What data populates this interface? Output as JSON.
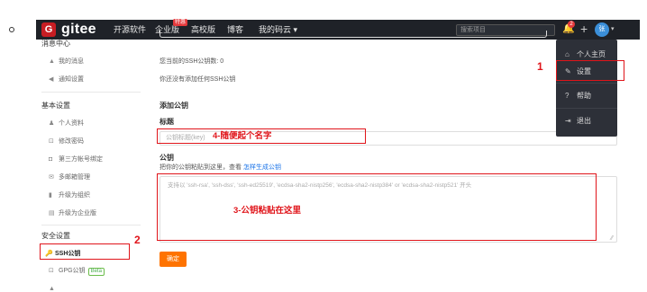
{
  "topnav": {
    "logo_text": "gitee",
    "items": [
      "开源软件",
      "企业版",
      "高校版",
      "博客",
      "我的码云 ▾"
    ],
    "enterprise_badge": "特惠",
    "search_placeholder": "搜索项目",
    "notification_count": "2",
    "avatar_text": "张"
  },
  "sidebar": {
    "message_center": "消息中心",
    "my_messages": "我的消息",
    "notification_settings": "通知设置",
    "basic_settings": "基本设置",
    "profile": "个人资料",
    "change_password": "修改密码",
    "third_party": "第三方帐号绑定",
    "multi_email": "多邮箱管理",
    "upgrade_org": "升级为组织",
    "upgrade_enterprise": "升级为企业版",
    "security_settings": "安全设置",
    "ssh_keys": "SSH公钥",
    "gpg_keys": "GPG公钥",
    "beta": "Beta"
  },
  "main": {
    "ssh_count": "您当前的SSH公钥数: 0",
    "no_keys": "你还没有添加任何SSH公钥",
    "add_key_heading": "添加公钥",
    "title_label": "标题",
    "title_placeholder": "公钥标题(key)",
    "key_label": "公钥",
    "key_hint": "把你的公钥粘贴到这里，查看",
    "key_hint_link": "怎样生成公钥",
    "key_placeholder": "支持以 'ssh-rsa', 'ssh-dss', 'ssh-ed25519', 'ecdsa-sha2-nistp256', 'ecdsa-sha2-nistp384' or 'ecdsa-sha2-nistp521' 开头",
    "confirm": "确定"
  },
  "dropdown": {
    "items": [
      "个人主页",
      "设置",
      "帮助",
      "退出"
    ]
  },
  "annotations": {
    "step1": "1",
    "step2": "2",
    "step3": "3-公钥粘贴在这里",
    "step4": "4-随便起个名字"
  },
  "colors": {
    "nav_bg": "#1f2228",
    "brand_red": "#c71d23",
    "annotation_red": "#e0141a",
    "confirm_orange": "#fe7300",
    "dropdown_bg": "#2d3038"
  }
}
